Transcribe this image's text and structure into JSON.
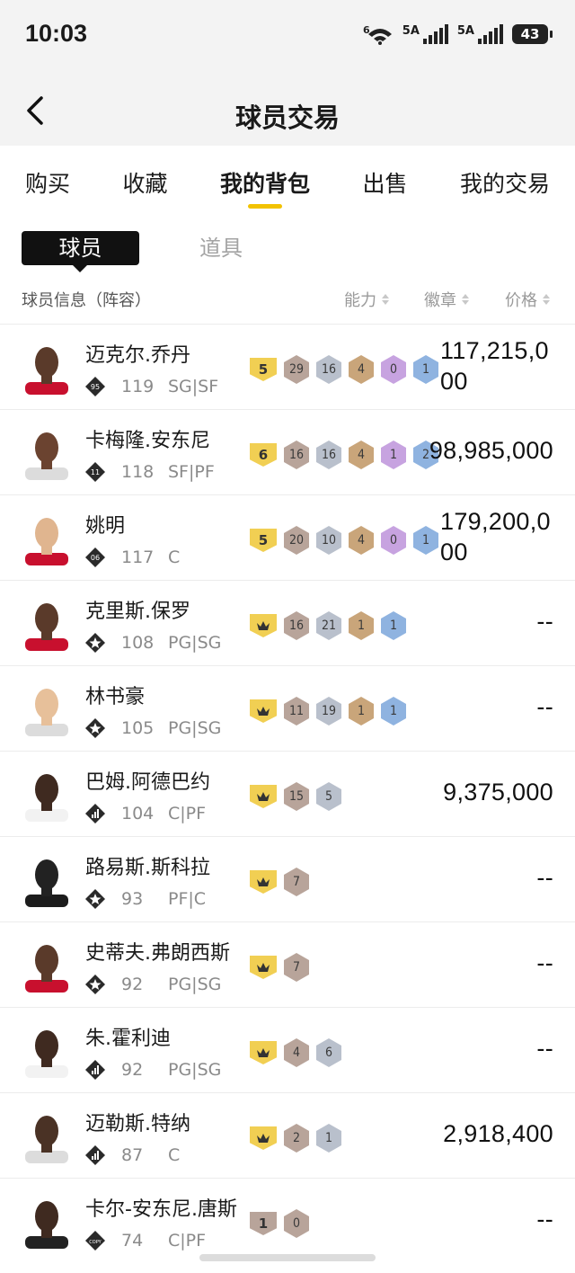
{
  "status": {
    "time": "10:03",
    "battery": "43",
    "net1": "5A",
    "net2": "5A",
    "wifi": "6"
  },
  "header": {
    "title": "球员交易"
  },
  "tabs": [
    {
      "label": "购买",
      "active": false
    },
    {
      "label": "收藏",
      "active": false
    },
    {
      "label": "我的背包",
      "active": true
    },
    {
      "label": "出售",
      "active": false
    },
    {
      "label": "我的交易",
      "active": false
    }
  ],
  "subtabs": [
    {
      "label": "球员",
      "active": true
    },
    {
      "label": "道具",
      "active": false
    }
  ],
  "columns": {
    "info": "球员信息（阵容）",
    "ability": "能力",
    "badge": "徽章",
    "price": "价格"
  },
  "colors": {
    "accent": "#f2c200",
    "gold": "#f1cf53",
    "bronze": "#c9a57a",
    "silver": "#b9c0cc",
    "copper": "#b8a49a",
    "purple": "#c7a3e0",
    "blue": "#8fb3e0"
  },
  "players": [
    {
      "name": "迈克尔.乔丹",
      "tier_icon": "tier-95-icon",
      "tier_text": "95",
      "ovr": "119",
      "pos": "SG|SF",
      "level": "5",
      "level_type": "gold",
      "badges": [
        {
          "v": "29",
          "c": "copper"
        },
        {
          "v": "16",
          "c": "silver"
        },
        {
          "v": "4",
          "c": "bronze"
        },
        {
          "v": "0",
          "c": "purple"
        },
        {
          "v": "1",
          "c": "blue"
        }
      ],
      "price": "117,215,000",
      "price_wrap": true
    },
    {
      "name": "卡梅隆.安东尼",
      "tier_icon": "tier-11-icon",
      "tier_text": "11",
      "ovr": "118",
      "pos": "SF|PF",
      "level": "6",
      "level_type": "gold",
      "badges": [
        {
          "v": "16",
          "c": "copper"
        },
        {
          "v": "16",
          "c": "silver"
        },
        {
          "v": "4",
          "c": "bronze"
        },
        {
          "v": "1",
          "c": "purple"
        },
        {
          "v": "2",
          "c": "blue"
        }
      ],
      "price": "98,985,000",
      "price_wrap": false
    },
    {
      "name": "姚明",
      "tier_icon": "tier-06-icon",
      "tier_text": "06",
      "ovr": "117",
      "pos": "C",
      "level": "5",
      "level_type": "gold",
      "badges": [
        {
          "v": "20",
          "c": "copper"
        },
        {
          "v": "10",
          "c": "silver"
        },
        {
          "v": "4",
          "c": "bronze"
        },
        {
          "v": "0",
          "c": "purple"
        },
        {
          "v": "1",
          "c": "blue"
        }
      ],
      "price": "179,200,000",
      "price_wrap": true
    },
    {
      "name": "克里斯.保罗",
      "tier_icon": "star-tier-icon",
      "tier_text": "",
      "ovr": "108",
      "pos": "PG|SG",
      "level": "",
      "level_type": "crown",
      "badges": [
        {
          "v": "16",
          "c": "copper"
        },
        {
          "v": "21",
          "c": "silver"
        },
        {
          "v": "1",
          "c": "bronze"
        },
        {
          "v": "1",
          "c": "blue"
        }
      ],
      "price": "--",
      "price_wrap": false
    },
    {
      "name": "林书豪",
      "tier_icon": "star-tier-icon",
      "tier_text": "",
      "ovr": "105",
      "pos": "PG|SG",
      "level": "",
      "level_type": "crown",
      "badges": [
        {
          "v": "11",
          "c": "copper"
        },
        {
          "v": "19",
          "c": "silver"
        },
        {
          "v": "1",
          "c": "bronze"
        },
        {
          "v": "1",
          "c": "blue"
        }
      ],
      "price": "--",
      "price_wrap": false
    },
    {
      "name": "巴姆.阿德巴约",
      "tier_icon": "bars-tier-icon",
      "tier_text": "",
      "ovr": "104",
      "pos": "C|PF",
      "level": "",
      "level_type": "crown",
      "badges": [
        {
          "v": "15",
          "c": "copper"
        },
        {
          "v": "5",
          "c": "silver"
        }
      ],
      "price": "9,375,000",
      "price_wrap": false
    },
    {
      "name": "路易斯.斯科拉",
      "tier_icon": "star-tier-icon",
      "tier_text": "",
      "ovr": "93",
      "pos": "PF|C",
      "level": "",
      "level_type": "crown",
      "badges": [
        {
          "v": "7",
          "c": "copper"
        }
      ],
      "price": "--",
      "price_wrap": false
    },
    {
      "name": "史蒂夫.弗朗西斯",
      "tier_icon": "star-tier-icon",
      "tier_text": "",
      "ovr": "92",
      "pos": "PG|SG",
      "level": "",
      "level_type": "crown",
      "badges": [
        {
          "v": "7",
          "c": "copper"
        }
      ],
      "price": "--",
      "price_wrap": false
    },
    {
      "name": "朱.霍利迪",
      "tier_icon": "bars-tier-icon",
      "tier_text": "",
      "ovr": "92",
      "pos": "PG|SG",
      "level": "",
      "level_type": "crown",
      "badges": [
        {
          "v": "4",
          "c": "copper"
        },
        {
          "v": "6",
          "c": "silver"
        }
      ],
      "price": "--",
      "price_wrap": false
    },
    {
      "name": "迈勒斯.特纳",
      "tier_icon": "bars-tier-icon",
      "tier_text": "",
      "ovr": "87",
      "pos": "C",
      "level": "",
      "level_type": "crown",
      "badges": [
        {
          "v": "2",
          "c": "copper"
        },
        {
          "v": "1",
          "c": "silver"
        }
      ],
      "price": "2,918,400",
      "price_wrap": false
    },
    {
      "name": "卡尔-安东尼.唐斯",
      "tier_icon": "copy-tier-icon",
      "tier_text": "COPY",
      "ovr": "74",
      "pos": "C|PF",
      "level": "1",
      "level_type": "copper",
      "badges": [
        {
          "v": "0",
          "c": "copper"
        }
      ],
      "price": "--",
      "price_wrap": false
    }
  ]
}
